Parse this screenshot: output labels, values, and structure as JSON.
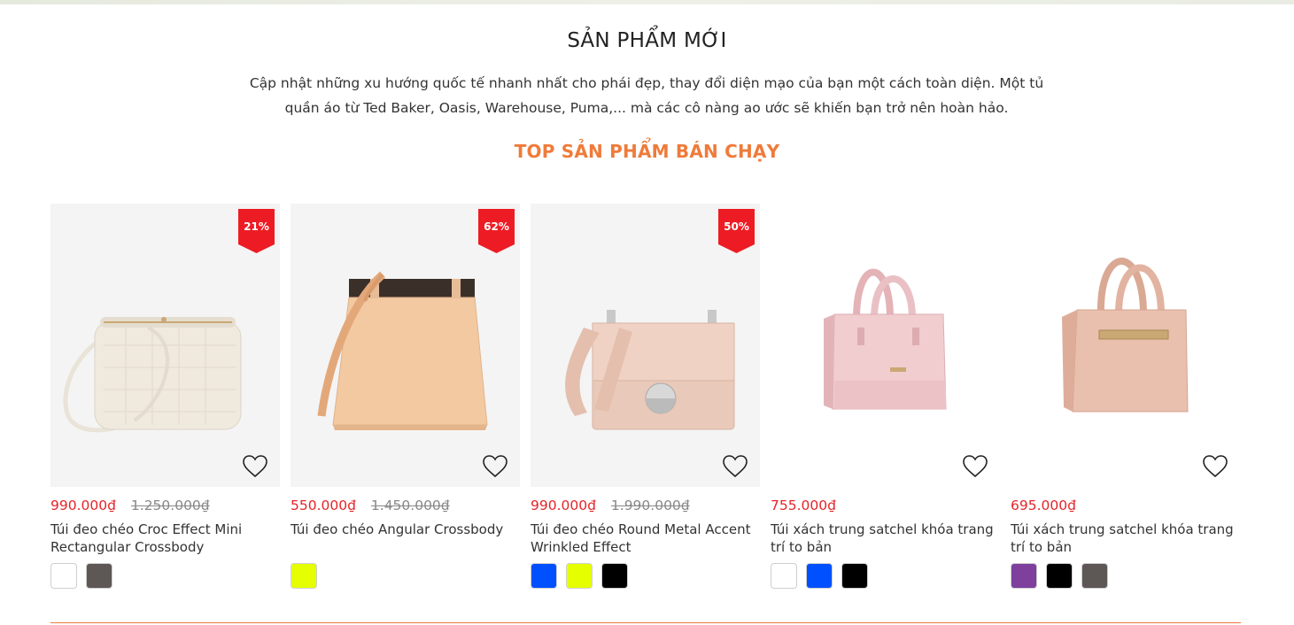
{
  "section": {
    "title": "SẢN PHẨM MỚI",
    "description": "Cập nhật những xu hướng quốc tế nhanh nhất cho phái đẹp, thay đổi diện mạo của bạn một cách toàn diện. Một tủ quần áo từ Ted Baker, Oasis, Warehouse, Puma,... mà các cô nàng ao ước sẽ khiến bạn trở nên hoàn hảo.",
    "subtitle": "TOP SẢN PHẨM BÁN CHẠY"
  },
  "colors": {
    "accent": "#ef7b3a",
    "sale": "#e52429",
    "badge": "#ed1c24"
  },
  "products": [
    {
      "badge": "21%",
      "price": "990.000₫",
      "old_price": "1.250.000₫",
      "name": "Túi đeo chéo Croc Effect Mini Rectangular Crossbody",
      "icon": "heart-icon",
      "swatches": [
        "#ffffff",
        "#5d5756"
      ]
    },
    {
      "badge": "62%",
      "price": "550.000₫",
      "old_price": "1.450.000₫",
      "name": "Túi đeo chéo Angular Crossbody",
      "icon": "heart-icon",
      "swatches": [
        "#e6ff00"
      ]
    },
    {
      "badge": "50%",
      "price": "990.000₫",
      "old_price": "1.990.000₫",
      "name": "Túi đeo chéo Round Metal Accent Wrinkled Effect",
      "icon": "heart-icon",
      "swatches": [
        "#0050ff",
        "#e6ff00",
        "#000000"
      ]
    },
    {
      "price": "755.000₫",
      "name": "Túi xách trung satchel khóa trang trí to bản",
      "icon": "heart-icon",
      "swatches": [
        "#ffffff",
        "#0050ff",
        "#000000"
      ]
    },
    {
      "price": "695.000₫",
      "name": "Túi xách trung satchel khóa trang trí to bản",
      "icon": "heart-icon",
      "swatches": [
        "#7e3f9d",
        "#000000",
        "#5d5756"
      ]
    }
  ]
}
